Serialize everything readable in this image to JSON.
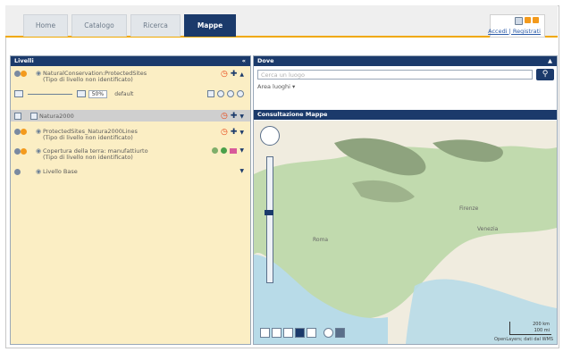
{
  "nav": {
    "tabs": [
      {
        "label": "Home"
      },
      {
        "label": "Catalogo"
      },
      {
        "label": "Ricerca"
      },
      {
        "label": "Mappe"
      }
    ],
    "login_text": "Accedi | Registrati"
  },
  "layers_panel": {
    "title": "Livelli",
    "layers": [
      {
        "name": "NaturalConservation:ProtectedSites",
        "sub": "(Tipo di livello non identificato)"
      },
      {
        "name": "Natura2000",
        "sub": ""
      },
      {
        "name": "ProtectedSites_Natura2000Lines",
        "sub": "(Tipo di livello non identificato)"
      },
      {
        "name": "Copertura della terra: manufattiurto",
        "sub": "(Tipo di livello non identificato)"
      },
      {
        "name": "Livello Base",
        "sub": ""
      }
    ],
    "opacity": "50%",
    "style": "default"
  },
  "where_panel": {
    "title": "Dove",
    "placeholder": "Cerca un luogo",
    "select": "Area luoghi"
  },
  "map_panel": {
    "title": "Consultazione Mappe",
    "places": [
      "Roma",
      "Firenze",
      "Venezia"
    ],
    "scale": [
      "200 km",
      "100 mi"
    ],
    "credit": "OpenLayers; dati dal WMS"
  }
}
